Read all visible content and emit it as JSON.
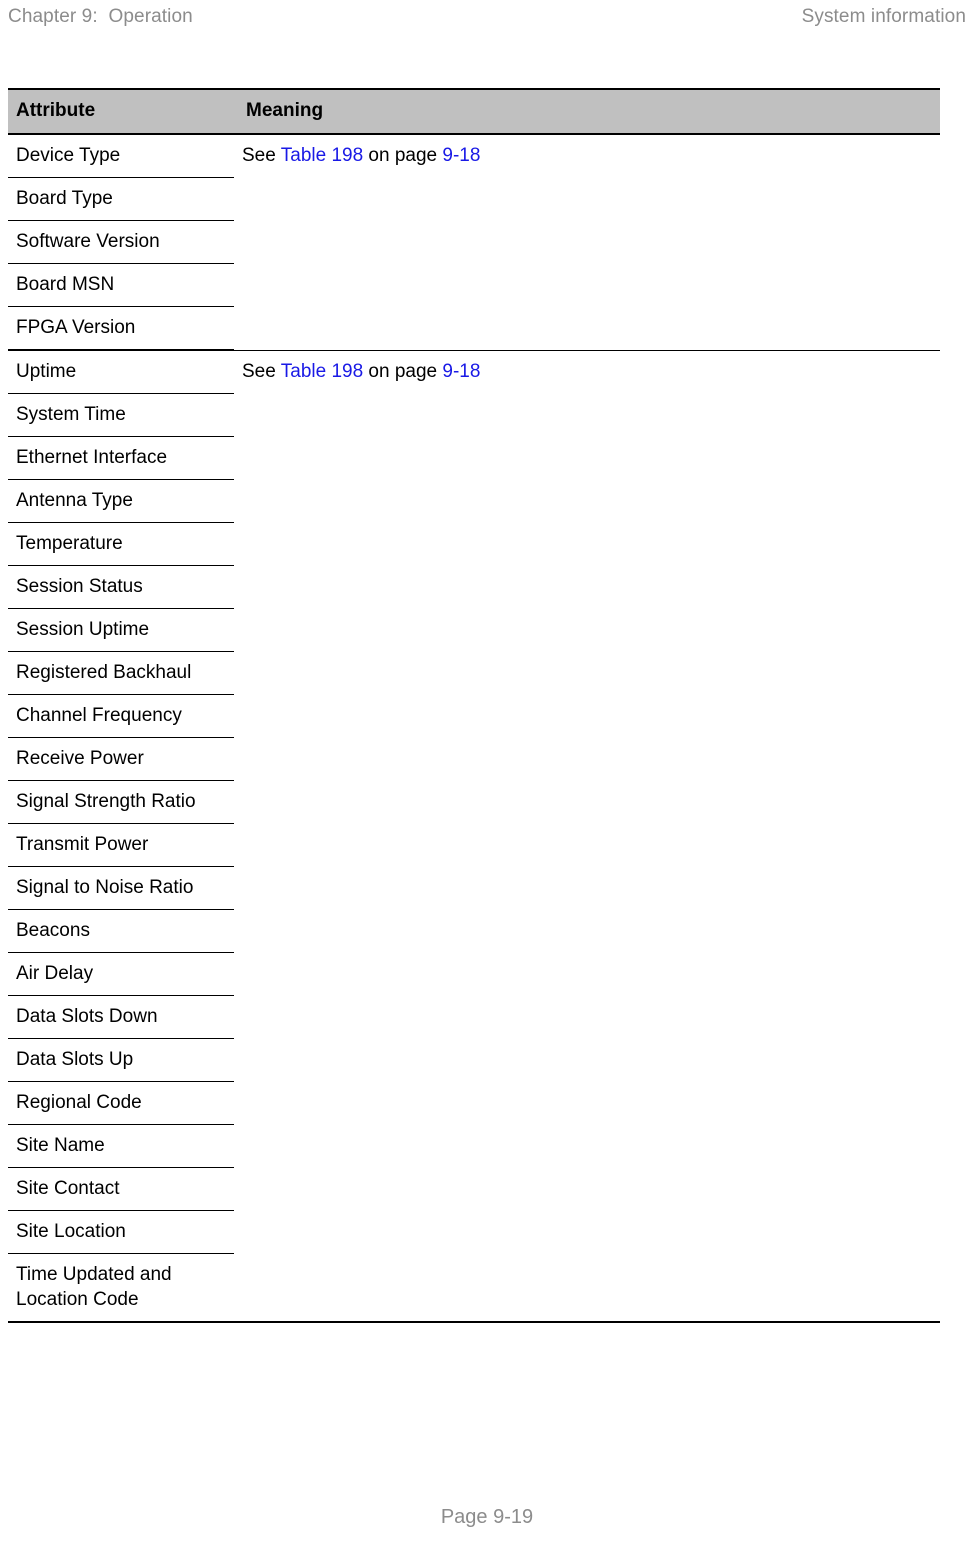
{
  "running_head": {
    "left": "Chapter 9:  Operation",
    "right": "System information"
  },
  "table": {
    "columns": {
      "attribute": "Attribute",
      "meaning": "Meaning"
    },
    "groups": [
      {
        "meaning": {
          "prefix": "See ",
          "link_table": "Table 198",
          "middle": " on page ",
          "link_page": "9-18"
        },
        "rows": [
          "Device Type",
          "Board Type",
          "Software Version",
          "Board MSN",
          "FPGA Version"
        ]
      },
      {
        "meaning": {
          "prefix": "See ",
          "link_table": "Table 198",
          "middle": " on page ",
          "link_page": "9-18"
        },
        "rows": [
          "Uptime",
          "System Time",
          "Ethernet Interface",
          "Antenna Type",
          "Temperature",
          "Session Status",
          "Session Uptime",
          "Registered Backhaul",
          "Channel Frequency",
          "Receive Power",
          "Signal Strength Ratio",
          "Transmit Power",
          "Signal to Noise Ratio",
          "Beacons",
          "Air Delay",
          "Data Slots Down",
          "Data Slots Up",
          "Regional Code",
          "Site Name",
          "Site Contact",
          "Site Location",
          "Time Updated and Location Code"
        ]
      }
    ]
  },
  "footer": {
    "page_label": "Page 9-19"
  },
  "colors": {
    "header_fill": "#c0c0c0",
    "link": "#1919e6",
    "running_head_text": "#8c8c8c",
    "rule": "#000000"
  }
}
